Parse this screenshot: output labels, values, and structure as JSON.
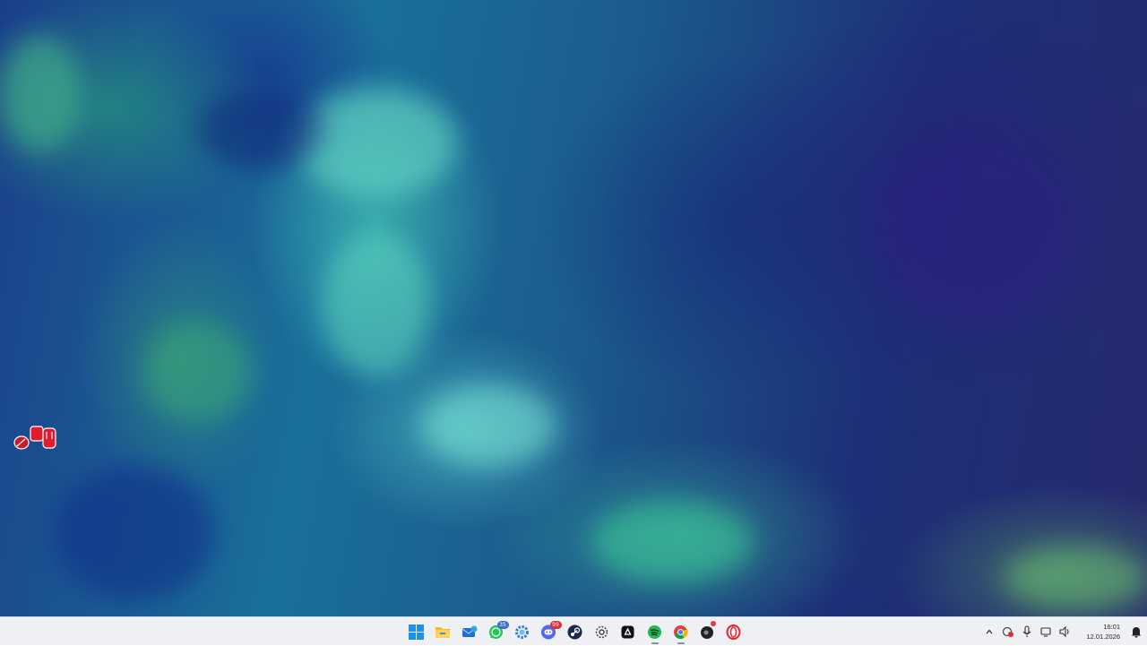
{
  "desktop": {
    "icons": [
      {
        "name": "app-shortcut-icon"
      }
    ]
  },
  "taskbar": {
    "apps": [
      {
        "name": "windows-start-icon"
      },
      {
        "name": "file-explorer-icon"
      },
      {
        "name": "mail-app-icon"
      },
      {
        "name": "whatsapp-icon",
        "badge": "35"
      },
      {
        "name": "settings-gear-icon"
      },
      {
        "name": "discord-icon",
        "badge": "99"
      },
      {
        "name": "steam-icon"
      },
      {
        "name": "recorder-icon"
      },
      {
        "name": "epic-games-icon"
      },
      {
        "name": "spotify-icon"
      },
      {
        "name": "chrome-icon"
      },
      {
        "name": "app-dark-icon"
      },
      {
        "name": "opera-icon"
      }
    ],
    "tray": {
      "icons": [
        "chevron-up-icon",
        "vpn-shield-icon",
        "microphone-icon",
        "network-icon",
        "volume-icon",
        "notification-bell-icon"
      ],
      "time": "16:01",
      "date": "12.01.2026"
    }
  }
}
